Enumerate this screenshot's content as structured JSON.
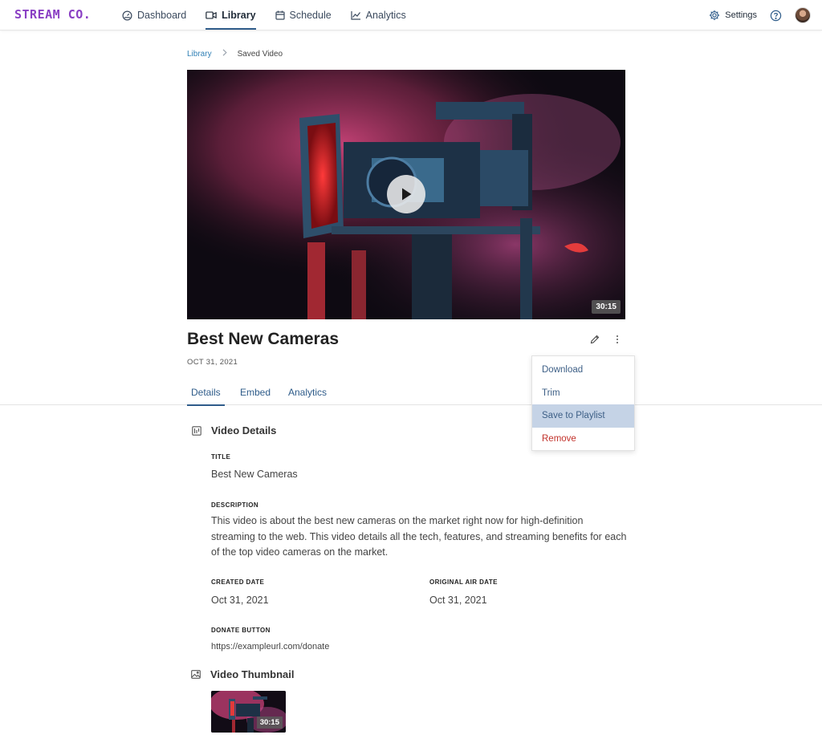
{
  "app": {
    "logo": "STREAM CO."
  },
  "nav": {
    "items": [
      {
        "label": "Dashboard",
        "icon": "gauge-icon"
      },
      {
        "label": "Library",
        "icon": "video-icon",
        "active": true
      },
      {
        "label": "Schedule",
        "icon": "calendar-icon"
      },
      {
        "label": "Analytics",
        "icon": "line-chart-icon"
      }
    ],
    "settings_label": "Settings"
  },
  "breadcrumb": {
    "parent": "Library",
    "current": "Saved Video"
  },
  "video": {
    "duration": "30:15",
    "title": "Best New Cameras",
    "date": "OCT 31, 2021"
  },
  "tabs": [
    {
      "label": "Details",
      "active": true
    },
    {
      "label": "Embed"
    },
    {
      "label": "Analytics"
    }
  ],
  "menu": {
    "items": [
      {
        "label": "Download"
      },
      {
        "label": "Trim"
      },
      {
        "label": "Save to Playlist",
        "hovered": true
      },
      {
        "label": "Remove",
        "danger": true
      }
    ]
  },
  "details": {
    "heading": "Video Details",
    "title_label": "TITLE",
    "title_value": "Best New Cameras",
    "description_label": "DESCRIPTION",
    "description_value": "This video is about the best new cameras on the market right now for high-definition streaming to the web. This video details all the tech, features, and streaming benefits for each of the top video cameras on the market.",
    "created_label": "CREATED DATE",
    "created_value": "Oct 31, 2021",
    "air_label": "ORIGINAL AIR DATE",
    "air_value": "Oct 31, 2021",
    "donate_label": "DONATE BUTTON",
    "donate_value": "https://exampleurl.com/donate"
  },
  "thumbnail": {
    "heading": "Video Thumbnail",
    "duration": "30:15"
  },
  "colors": {
    "accent": "#2f5c8a",
    "brand": "#8a3fc4",
    "danger": "#c2322b",
    "menu_hover": "#c5d3e6",
    "link": "#2f7fb5"
  }
}
